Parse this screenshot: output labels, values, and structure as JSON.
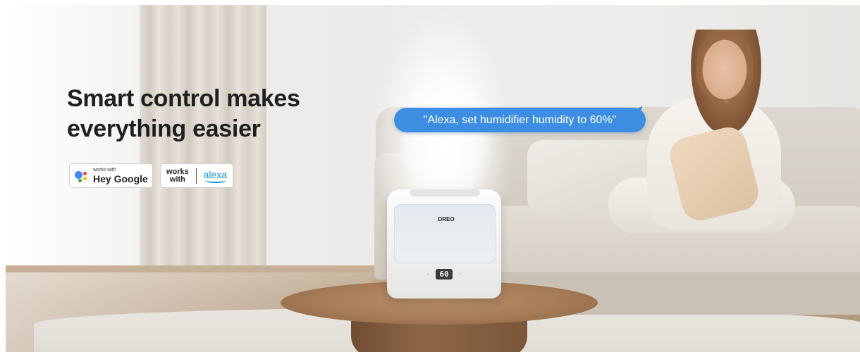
{
  "banner": {
    "headline_line1": "Smart control makes",
    "headline_line2": "everything easier",
    "speech_bubble": "\"Alexa, set humidifier humidity to 60%\"",
    "badges": {
      "google_small": "works with",
      "google_big": "Hey Google",
      "alexa_works": "works",
      "alexa_with": "with",
      "alexa_word": "alexa"
    },
    "device": {
      "brand": "DREO",
      "display": "60"
    }
  },
  "colors": {
    "bubble": "#3d8ee3",
    "headline": "#1f1f1f",
    "alexa": "#1a98d5"
  }
}
